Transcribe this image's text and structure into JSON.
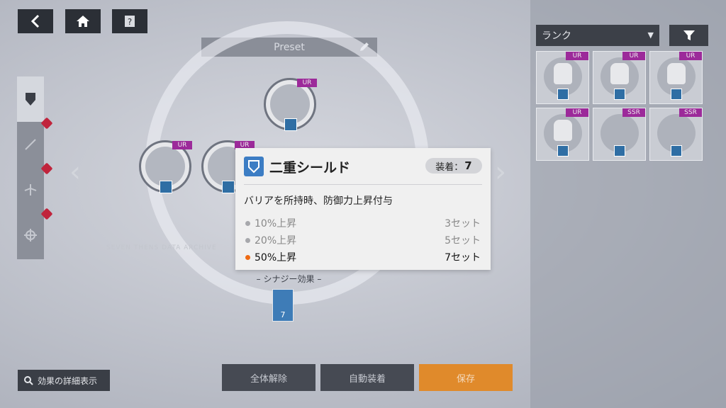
{
  "topbar": {
    "back_icon": "chevron-left-icon",
    "home_icon": "home-icon",
    "help_icon": "help-icon"
  },
  "preset": {
    "label": "Preset",
    "edit_icon": "pencil-icon"
  },
  "left_tabs": [
    "shield-icon",
    "sword-icon",
    "plane-icon",
    "crosshair-icon"
  ],
  "nodes": [
    {
      "rank": "UR"
    },
    {
      "rank": "UR"
    },
    {
      "rank": "UR"
    }
  ],
  "synergy": {
    "label": "シナジー効果",
    "count": "7"
  },
  "faint_text": "SEVEN THENS DATA ARCHIVE",
  "detail_button": {
    "label": "効果の詳細表示"
  },
  "bottom_buttons": {
    "release_all": "全体解除",
    "auto_equip": "自動装着",
    "save": "保存"
  },
  "right_panel": {
    "sort_label": "ランク",
    "cards": [
      {
        "rank": "UR"
      },
      {
        "rank": "UR"
      },
      {
        "rank": "UR"
      },
      {
        "rank": "UR"
      },
      {
        "rank": "SSR"
      },
      {
        "rank": "SSR"
      }
    ]
  },
  "popup": {
    "title": "二重シールド",
    "equip_label": "装着：",
    "equip_count": "7",
    "description": "バリアを所持時、防御力上昇付与",
    "tiers": [
      {
        "effect": "10%上昇",
        "sets": "3セット",
        "active": false
      },
      {
        "effect": "20%上昇",
        "sets": "5セット",
        "active": false
      },
      {
        "effect": "50%上昇",
        "sets": "7セット",
        "active": true
      }
    ]
  },
  "colors": {
    "accent_orange": "#e08a2b",
    "rank_purple": "#9c2a9a",
    "active_dot": "#ee6a13"
  }
}
